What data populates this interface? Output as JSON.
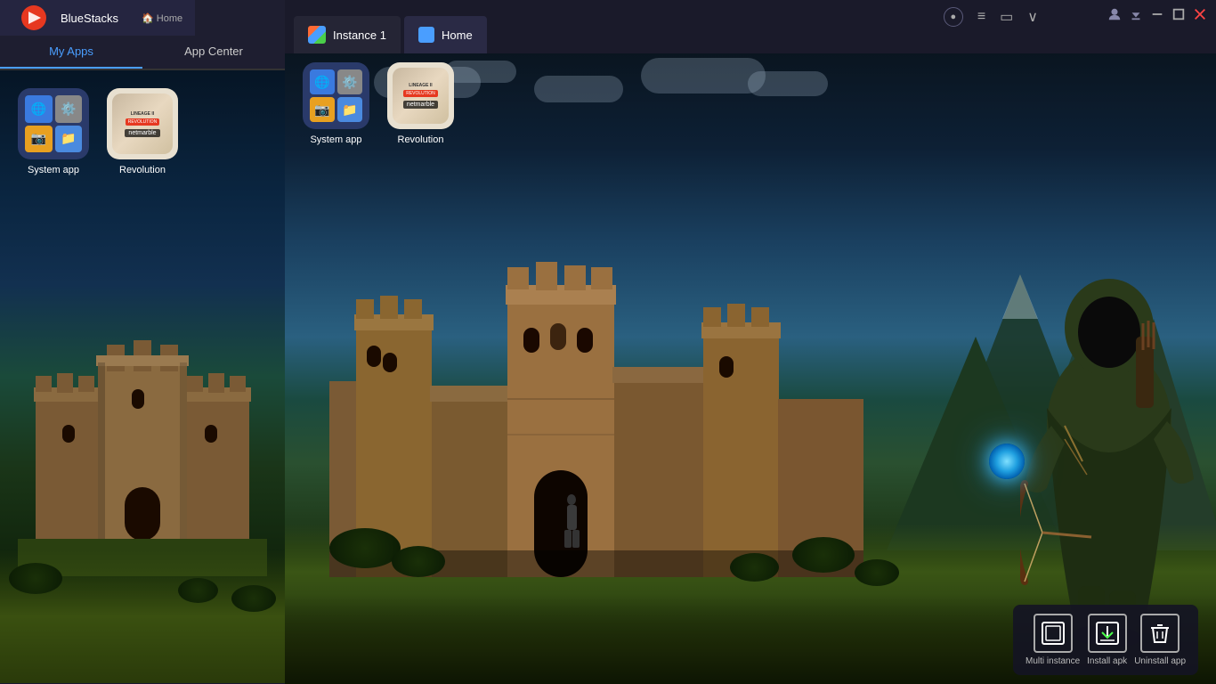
{
  "app": {
    "name": "BlueStacks",
    "title": "Home"
  },
  "left_panel": {
    "title": "Home",
    "nav_tabs": [
      {
        "label": "My Apps",
        "active": true
      },
      {
        "label": "App Center",
        "active": false
      }
    ],
    "apps": [
      {
        "label": "System app"
      },
      {
        "label": "Revolution"
      }
    ]
  },
  "right_window": {
    "tabs": [
      {
        "label": "Instance 1"
      },
      {
        "label": "Home"
      }
    ]
  },
  "toolbar": {
    "items": [
      {
        "label": "Multi instance"
      },
      {
        "label": "Install apk"
      },
      {
        "label": "Uninstall app"
      }
    ]
  }
}
